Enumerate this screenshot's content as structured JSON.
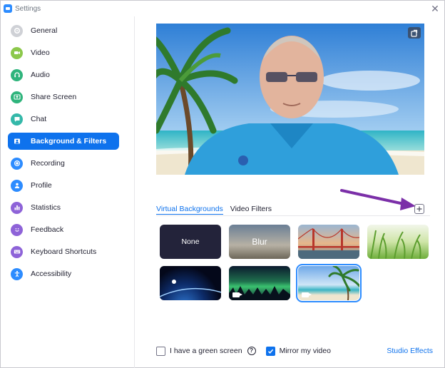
{
  "window": {
    "title": "Settings"
  },
  "sidebar": {
    "items": [
      {
        "label": "General",
        "icon": "gear-icon",
        "color": "#cfd1d6"
      },
      {
        "label": "Video",
        "icon": "video-icon",
        "color": "#8cc84b"
      },
      {
        "label": "Audio",
        "icon": "headphones-icon",
        "color": "#2fb47c"
      },
      {
        "label": "Share Screen",
        "icon": "share-screen-icon",
        "color": "#2fb47c"
      },
      {
        "label": "Chat",
        "icon": "chat-icon",
        "color": "#34b8a9"
      },
      {
        "label": "Background & Filters",
        "icon": "portrait-icon",
        "color": "#0e72ed",
        "active": true
      },
      {
        "label": "Recording",
        "icon": "record-icon",
        "color": "#2d8cff"
      },
      {
        "label": "Profile",
        "icon": "person-icon",
        "color": "#2d8cff"
      },
      {
        "label": "Statistics",
        "icon": "bar-chart-icon",
        "color": "#8e63d8"
      },
      {
        "label": "Feedback",
        "icon": "smiley-icon",
        "color": "#8e63d8"
      },
      {
        "label": "Keyboard Shortcuts",
        "icon": "keyboard-icon",
        "color": "#8e63d8"
      },
      {
        "label": "Accessibility",
        "icon": "accessibility-icon",
        "color": "#2d8cff"
      }
    ]
  },
  "tabs": [
    {
      "label": "Virtual Backgrounds",
      "active": true
    },
    {
      "label": "Video Filters",
      "active": false
    }
  ],
  "backgrounds": [
    {
      "label": "None",
      "name": "background-none"
    },
    {
      "label": "Blur",
      "name": "background-blur"
    },
    {
      "label": "",
      "name": "background-golden-gate"
    },
    {
      "label": "",
      "name": "background-grass"
    },
    {
      "label": "",
      "name": "background-earth"
    },
    {
      "label": "",
      "name": "background-aurora",
      "video": true
    },
    {
      "label": "",
      "name": "background-beach",
      "video": true,
      "selected": true
    }
  ],
  "footer": {
    "green_screen_label": "I have a green screen",
    "green_screen_checked": false,
    "help_glyph": "?",
    "mirror_label": "Mirror my video",
    "mirror_checked": true,
    "studio_effects_label": "Studio Effects"
  },
  "colors": {
    "accent": "#0e72ed",
    "annotation_arrow": "#7b2fa8"
  }
}
